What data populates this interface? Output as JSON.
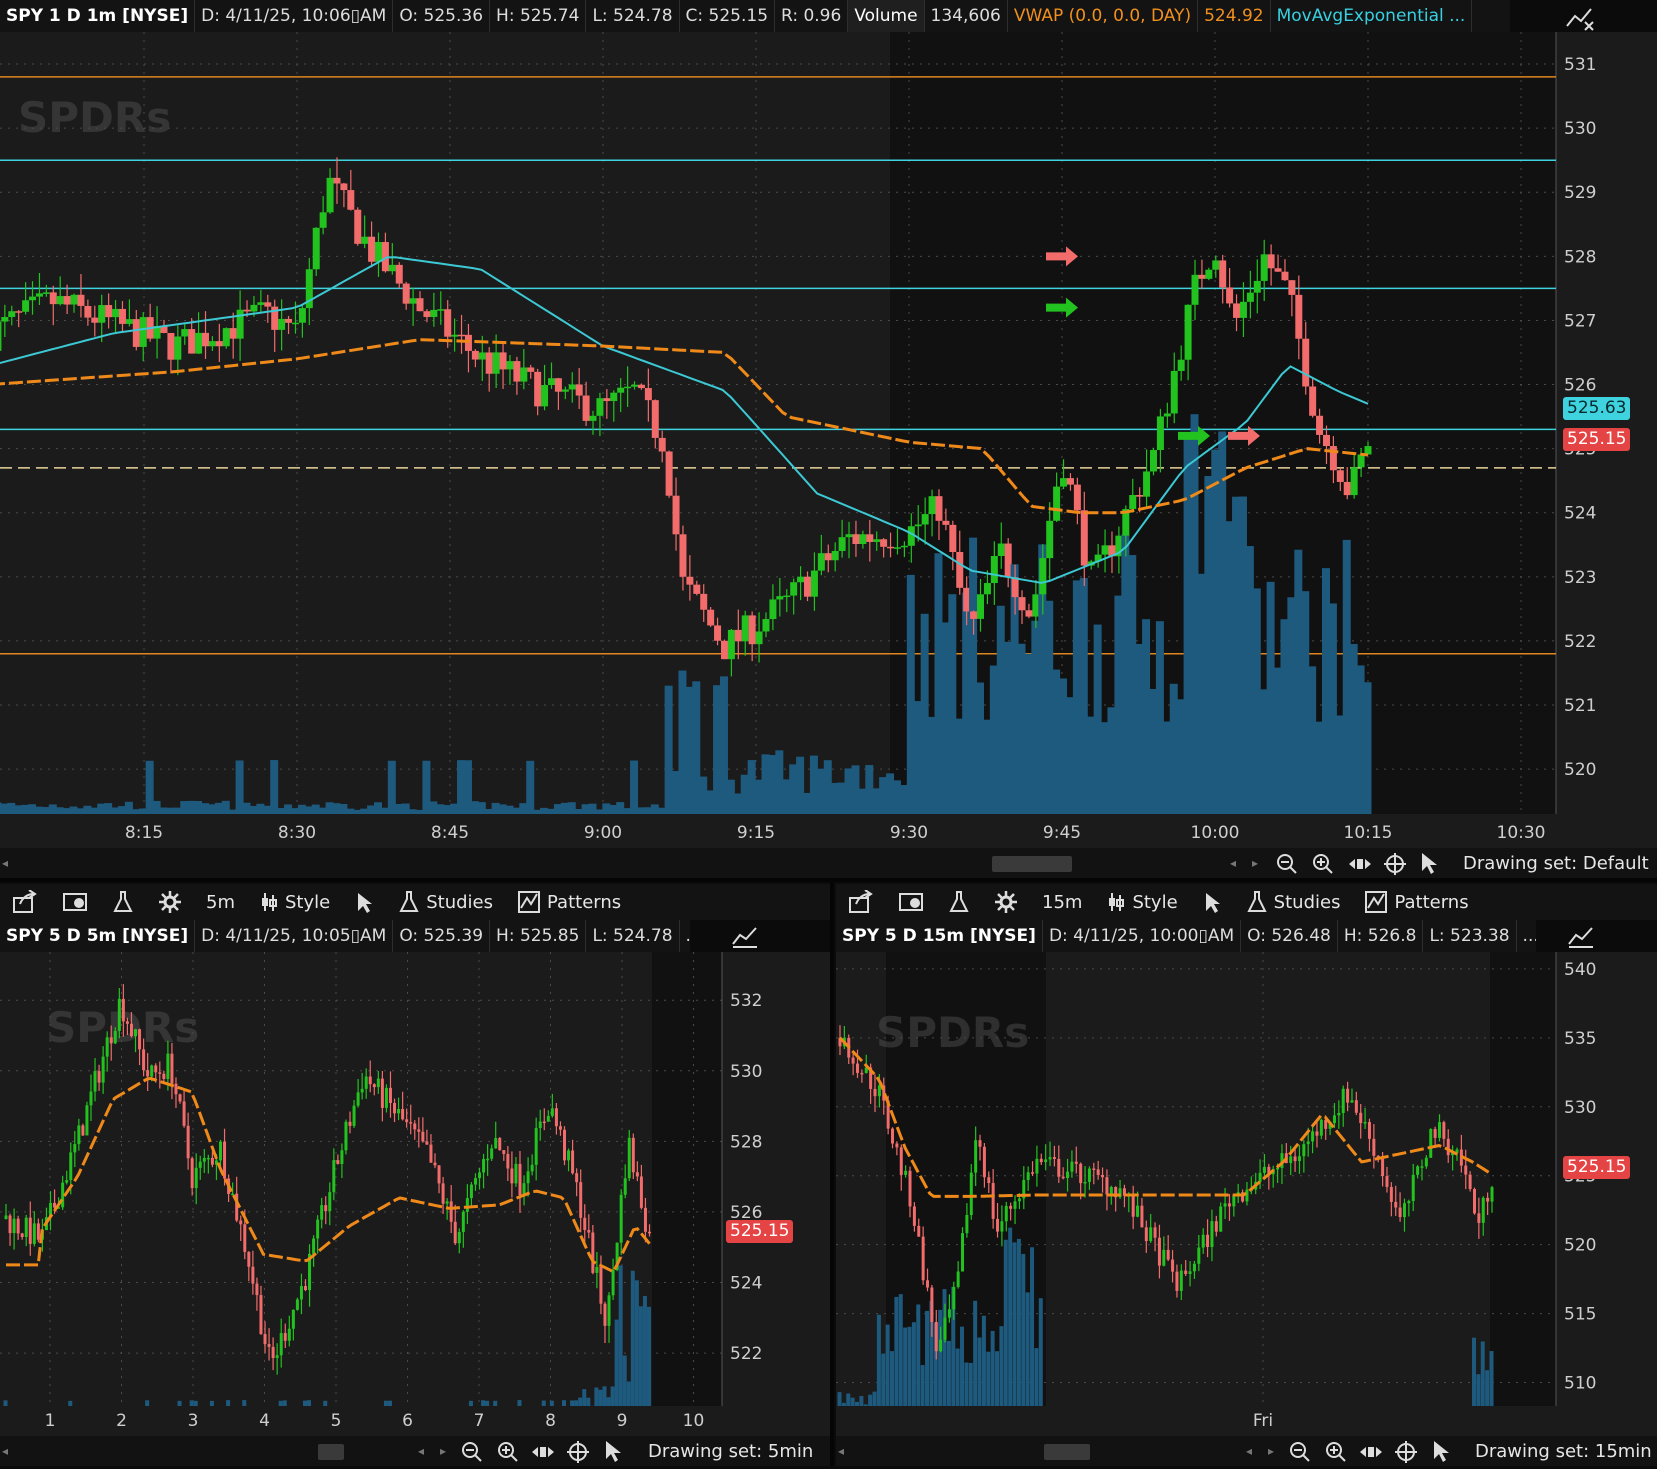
{
  "main_chart": {
    "header": {
      "symbol": "SPY 1 D 1m [NYSE]",
      "date": "D: 4/11/25, 10:06▯AM",
      "open": "O: 525.36",
      "high": "H: 525.74",
      "low": "L: 524.78",
      "close": "C: 525.15",
      "range": "R: 0.96",
      "volume_label": "Volume",
      "volume_value": "134,606",
      "vwap_label": "VWAP (0.0, 0.0, DAY)",
      "vwap_value": "524.92",
      "ema_label": "MovAvgExponential ..."
    },
    "ema_tag": "525.63",
    "last_tag": "525.15",
    "drawing_set": "Drawing set: Default"
  },
  "panel_5m": {
    "toolbar": {
      "period": "5m",
      "style": "Style",
      "studies": "Studies",
      "patterns": "Patterns"
    },
    "header": {
      "symbol": "SPY 5 D 5m [NYSE]",
      "date": "D: 4/11/25, 10:05▯AM",
      "open": "O: 525.39",
      "high": "H: 525.85",
      "low": "L: 524.78",
      "more": "..."
    },
    "last_tag": "525.15",
    "drawing_set": "Drawing set: 5min"
  },
  "panel_15m": {
    "toolbar": {
      "period": "15m",
      "style": "Style",
      "studies": "Studies",
      "patterns": "Patterns"
    },
    "header": {
      "symbol": "SPY 5 D 15m [NYSE]",
      "date": "D: 4/11/25, 10:00▯AM",
      "open": "O: 526.48",
      "high": "H: 526.8",
      "low": "L: 523.38",
      "more": "..."
    },
    "last_tag": "525.15",
    "drawing_set": "Drawing set: 15min"
  },
  "watermark": "SPDRs",
  "colors": {
    "up": "#22c31f",
    "down": "#f26c6c",
    "ema": "#3cc9d4",
    "vwap": "#ef8a1a",
    "volume": "#1d5a7e",
    "level_cyan": "#3fd3e0",
    "level_orange": "#e0861f",
    "level_dashed": "#e8d49a"
  },
  "chart_data": [
    {
      "id": "main",
      "type": "candlestick",
      "timeframe": "1m",
      "x_ticks": [
        "8:15",
        "8:30",
        "8:45",
        "9:00",
        "9:15",
        "9:30",
        "9:45",
        "10:00",
        "10:15",
        "10:30"
      ],
      "y_ticks": [
        520,
        521,
        522,
        523,
        524,
        525,
        526,
        527,
        528,
        529,
        530,
        531
      ],
      "ylim": [
        519.3,
        531.5
      ],
      "horizontal_levels": {
        "cyan": [
          529.5,
          527.5,
          525.3
        ],
        "orange": [
          530.8,
          521.8
        ],
        "dashed": [
          524.7
        ]
      },
      "price_keypoints": [
        [
          8.0,
          526.8
        ],
        [
          8.1,
          527.3
        ],
        [
          8.3,
          526.6
        ],
        [
          8.45,
          527.1
        ],
        [
          8.5,
          526.8
        ],
        [
          8.55,
          529.2
        ],
        [
          8.62,
          528.1
        ],
        [
          8.7,
          527.2
        ],
        [
          8.8,
          526.4
        ],
        [
          8.9,
          525.9
        ],
        [
          9.0,
          525.6
        ],
        [
          9.05,
          525.9
        ],
        [
          9.1,
          525.1
        ],
        [
          9.13,
          522.9
        ],
        [
          9.2,
          521.9
        ],
        [
          9.3,
          522.6
        ],
        [
          9.4,
          523.6
        ],
        [
          9.5,
          523.7
        ],
        [
          9.55,
          524.1
        ],
        [
          9.6,
          522.1
        ],
        [
          9.65,
          523.4
        ],
        [
          9.7,
          522.4
        ],
        [
          9.75,
          524.9
        ],
        [
          9.8,
          522.9
        ],
        [
          9.9,
          524.9
        ],
        [
          9.97,
          527.6
        ],
        [
          10.0,
          528.2
        ],
        [
          10.03,
          526.9
        ],
        [
          10.08,
          528.0
        ],
        [
          10.12,
          527.4
        ],
        [
          10.17,
          525.3
        ],
        [
          10.2,
          524.8
        ],
        [
          10.22,
          524.3
        ],
        [
          10.25,
          525.1
        ]
      ],
      "ema_keypoints": [
        [
          8.0,
          526.3
        ],
        [
          8.2,
          526.8
        ],
        [
          8.5,
          527.2
        ],
        [
          8.65,
          528.0
        ],
        [
          8.8,
          527.8
        ],
        [
          9.0,
          526.6
        ],
        [
          9.2,
          525.9
        ],
        [
          9.35,
          524.3
        ],
        [
          9.5,
          523.7
        ],
        [
          9.6,
          523.1
        ],
        [
          9.72,
          522.9
        ],
        [
          9.85,
          523.4
        ],
        [
          9.95,
          524.7
        ],
        [
          10.05,
          525.4
        ],
        [
          10.12,
          526.3
        ],
        [
          10.2,
          525.9
        ],
        [
          10.25,
          525.7
        ]
      ],
      "vwap_keypoints": [
        [
          8.0,
          526.0
        ],
        [
          8.3,
          526.2
        ],
        [
          8.5,
          526.4
        ],
        [
          8.7,
          526.7
        ],
        [
          9.0,
          526.6
        ],
        [
          9.2,
          526.5
        ],
        [
          9.3,
          525.5
        ],
        [
          9.5,
          525.1
        ],
        [
          9.62,
          525.0
        ],
        [
          9.7,
          524.1
        ],
        [
          9.78,
          524.0
        ],
        [
          9.85,
          524.0
        ],
        [
          9.95,
          524.2
        ],
        [
          10.05,
          524.7
        ],
        [
          10.15,
          525.0
        ],
        [
          10.25,
          524.9
        ]
      ]
    },
    {
      "id": "5m",
      "type": "candlestick",
      "timeframe": "5m",
      "x_ticks": [
        "1",
        "2",
        "3",
        "4",
        "5",
        "6",
        "7",
        "8",
        "9",
        "10"
      ],
      "y_ticks": [
        522,
        524,
        526,
        528,
        530,
        532
      ],
      "ylim": [
        520.5,
        532.8
      ],
      "price_keypoints": [
        [
          0,
          525.8
        ],
        [
          0.5,
          525.2
        ],
        [
          1,
          528
        ],
        [
          1.6,
          532
        ],
        [
          2,
          529.8
        ],
        [
          2.3,
          530.2
        ],
        [
          2.6,
          527
        ],
        [
          3,
          527.8
        ],
        [
          3.4,
          524.6
        ],
        [
          3.7,
          521.6
        ],
        [
          4.2,
          524.2
        ],
        [
          4.6,
          527.2
        ],
        [
          5,
          529.9
        ],
        [
          5.5,
          528.7
        ],
        [
          5.9,
          527.6
        ],
        [
          6.3,
          525.3
        ],
        [
          6.8,
          528.1
        ],
        [
          7.2,
          526.8
        ],
        [
          7.6,
          529.1
        ],
        [
          8,
          526.5
        ],
        [
          8.4,
          522.8
        ],
        [
          8.7,
          528.0
        ],
        [
          9.0,
          525.3
        ]
      ],
      "vwap_keypoints": [
        [
          0,
          524.5
        ],
        [
          0.45,
          524.5
        ],
        [
          0.5,
          525.5
        ],
        [
          1,
          527
        ],
        [
          1.5,
          529.2
        ],
        [
          2,
          529.8
        ],
        [
          2.6,
          529.4
        ],
        [
          3.0,
          527.2
        ],
        [
          3.6,
          524.8
        ],
        [
          4.2,
          524.6
        ],
        [
          4.8,
          525.6
        ],
        [
          5.5,
          526.4
        ],
        [
          6.2,
          526.1
        ],
        [
          6.9,
          526.2
        ],
        [
          7.4,
          526.6
        ],
        [
          7.8,
          526.4
        ],
        [
          8.2,
          524.6
        ],
        [
          8.5,
          524.3
        ],
        [
          8.8,
          525.6
        ],
        [
          9.0,
          525.1
        ]
      ]
    },
    {
      "id": "15m",
      "type": "candlestick",
      "timeframe": "15m",
      "x_ticks": [
        "Fri"
      ],
      "y_ticks": [
        510,
        515,
        520,
        525,
        530,
        535,
        540
      ],
      "ylim": [
        508.3,
        540.5
      ],
      "price_keypoints": [
        [
          0,
          535
        ],
        [
          0.06,
          531
        ],
        [
          0.11,
          523
        ],
        [
          0.15,
          512
        ],
        [
          0.18,
          517
        ],
        [
          0.21,
          528.5
        ],
        [
          0.24,
          521
        ],
        [
          0.3,
          526
        ],
        [
          0.38,
          525
        ],
        [
          0.43,
          524
        ],
        [
          0.52,
          517
        ],
        [
          0.6,
          523.5
        ],
        [
          0.7,
          526.5
        ],
        [
          0.78,
          531
        ],
        [
          0.82,
          527
        ],
        [
          0.86,
          521.5
        ],
        [
          0.91,
          528.5
        ],
        [
          0.95,
          526.5
        ],
        [
          0.98,
          521.5
        ],
        [
          1.0,
          525
        ]
      ],
      "vwap_keypoints": [
        [
          0,
          535
        ],
        [
          0.06,
          532
        ],
        [
          0.1,
          527
        ],
        [
          0.14,
          523.5
        ],
        [
          0.2,
          523.5
        ],
        [
          0.3,
          523.6
        ],
        [
          0.62,
          523.6
        ],
        [
          0.68,
          526
        ],
        [
          0.74,
          529.5
        ],
        [
          0.8,
          526
        ],
        [
          0.86,
          526.6
        ],
        [
          0.92,
          527.2
        ],
        [
          0.97,
          526
        ],
        [
          1.0,
          525.1
        ]
      ]
    }
  ]
}
